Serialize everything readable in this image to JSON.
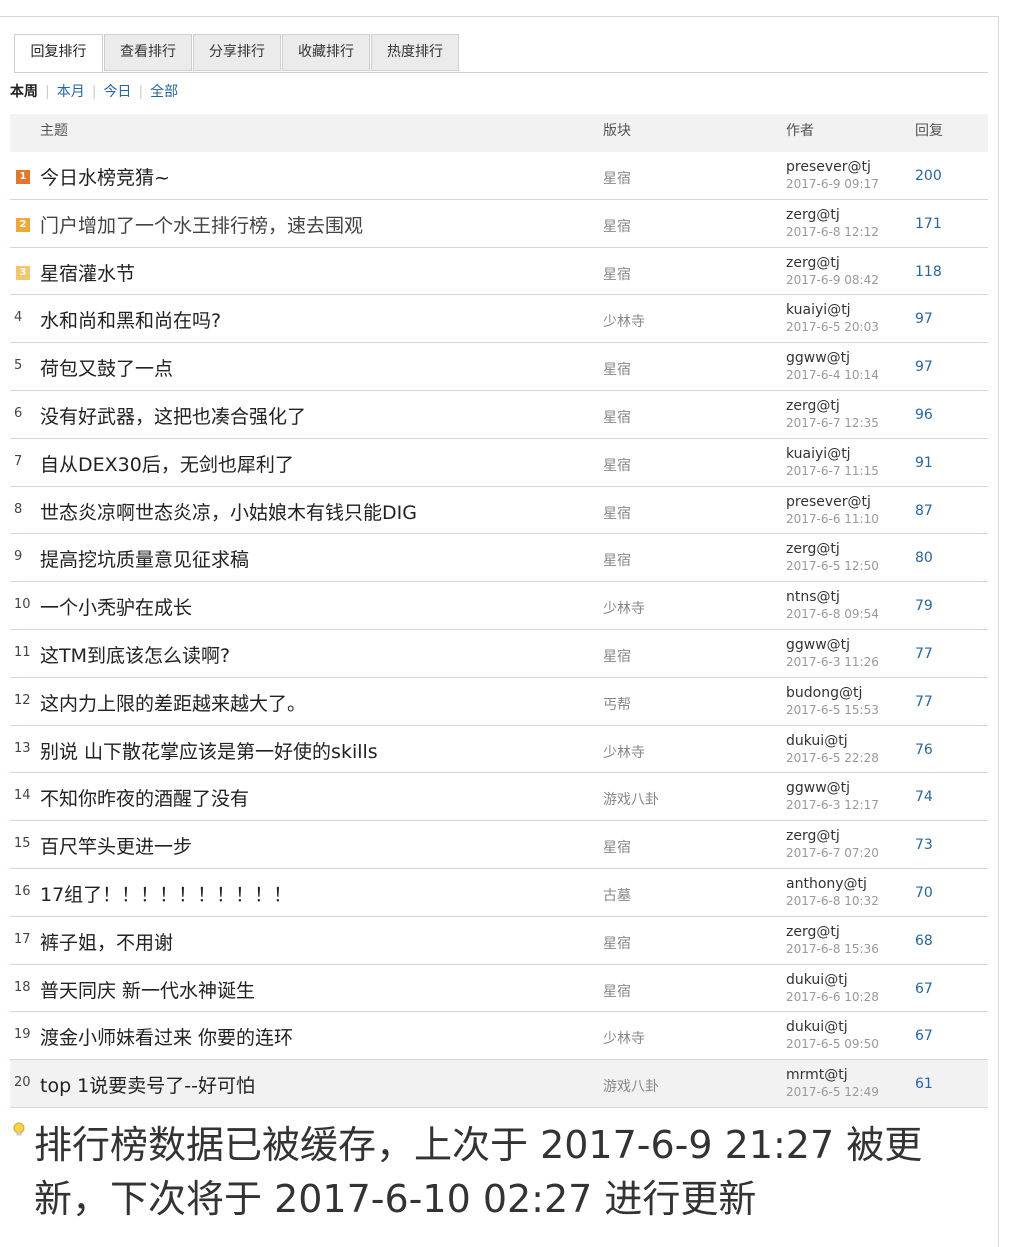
{
  "tabs": [
    "回复排行",
    "查看排行",
    "分享排行",
    "收藏排行",
    "热度排行"
  ],
  "filters": {
    "current": "本周",
    "links": [
      "本月",
      "今日",
      "全部"
    ]
  },
  "columns": {
    "subject": "主题",
    "forum": "版块",
    "author": "作者",
    "replies": "回复"
  },
  "colors": {
    "rank1": "#e4762a",
    "rank2": "#f0a838",
    "rank3": "#f5c56a",
    "link": "#2366a8"
  },
  "rows": [
    {
      "rank": "1",
      "title": "今日水榜竞猜~",
      "forum": "星宿",
      "author": "presever@tj",
      "time": "2017-6-9 09:17",
      "replies": "200"
    },
    {
      "rank": "2",
      "title": "门户增加了一个水王排行榜，速去围观",
      "forum": "星宿",
      "author": "zerg@tj",
      "time": "2017-6-8 12:12",
      "replies": "171"
    },
    {
      "rank": "3",
      "title": "星宿灌水节",
      "forum": "星宿",
      "author": "zerg@tj",
      "time": "2017-6-9 08:42",
      "replies": "118"
    },
    {
      "rank": "4",
      "title": "水和尚和黑和尚在吗?",
      "forum": "少林寺",
      "author": "kuaiyi@tj",
      "time": "2017-6-5 20:03",
      "replies": "97"
    },
    {
      "rank": "5",
      "title": "荷包又鼓了一点",
      "forum": "星宿",
      "author": "ggww@tj",
      "time": "2017-6-4 10:14",
      "replies": "97"
    },
    {
      "rank": "6",
      "title": "没有好武器，这把也凑合强化了",
      "forum": "星宿",
      "author": "zerg@tj",
      "time": "2017-6-7 12:35",
      "replies": "96"
    },
    {
      "rank": "7",
      "title": "自从DEX30后，无剑也犀利了",
      "forum": "星宿",
      "author": "kuaiyi@tj",
      "time": "2017-6-7 11:15",
      "replies": "91"
    },
    {
      "rank": "8",
      "title": "世态炎凉啊世态炎凉，小姑娘木有钱只能DIG",
      "forum": "星宿",
      "author": "presever@tj",
      "time": "2017-6-6 11:10",
      "replies": "87"
    },
    {
      "rank": "9",
      "title": "提高挖坑质量意见征求稿",
      "forum": "星宿",
      "author": "zerg@tj",
      "time": "2017-6-5 12:50",
      "replies": "80"
    },
    {
      "rank": "10",
      "title": "一个小秃驴在成长",
      "forum": "少林寺",
      "author": "ntns@tj",
      "time": "2017-6-8 09:54",
      "replies": "79"
    },
    {
      "rank": "11",
      "title": "这TM到底该怎么读啊?",
      "forum": "星宿",
      "author": "ggww@tj",
      "time": "2017-6-3 11:26",
      "replies": "77"
    },
    {
      "rank": "12",
      "title": "这内力上限的差距越来越大了。",
      "forum": "丐帮",
      "author": "budong@tj",
      "time": "2017-6-5 15:53",
      "replies": "77"
    },
    {
      "rank": "13",
      "title": "别说 山下散花掌应该是第一好使的skills",
      "forum": "少林寺",
      "author": "dukui@tj",
      "time": "2017-6-5 22:28",
      "replies": "76"
    },
    {
      "rank": "14",
      "title": "不知你昨夜的酒醒了没有",
      "forum": "游戏八卦",
      "author": "ggww@tj",
      "time": "2017-6-3 12:17",
      "replies": "74"
    },
    {
      "rank": "15",
      "title": "百尺竿头更进一步",
      "forum": "星宿",
      "author": "zerg@tj",
      "time": "2017-6-7 07:20",
      "replies": "73"
    },
    {
      "rank": "16",
      "title": "17组了！！！！！！！！！！",
      "forum": "古墓",
      "author": "anthony@tj",
      "time": "2017-6-8 10:32",
      "replies": "70"
    },
    {
      "rank": "17",
      "title": "裤子姐，不用谢",
      "forum": "星宿",
      "author": "zerg@tj",
      "time": "2017-6-8 15:36",
      "replies": "68"
    },
    {
      "rank": "18",
      "title": "普天同庆 新一代水神诞生",
      "forum": "星宿",
      "author": "dukui@tj",
      "time": "2017-6-6 10:28",
      "replies": "67"
    },
    {
      "rank": "19",
      "title": "渡金小师妹看过来 你要的连环",
      "forum": "少林寺",
      "author": "dukui@tj",
      "time": "2017-6-5 09:50",
      "replies": "67"
    },
    {
      "rank": "20",
      "title": "top 1说要卖号了--好可怕",
      "forum": "游戏八卦",
      "author": "mrmt@tj",
      "time": "2017-6-5 12:49",
      "replies": "61"
    }
  ],
  "notice": {
    "icon": "lightbulb-icon",
    "text": "排行榜数据已被缓存，上次于 2017-6-9 21:27 被更新，下次将于 2017-6-10 02:27 进行更新"
  }
}
